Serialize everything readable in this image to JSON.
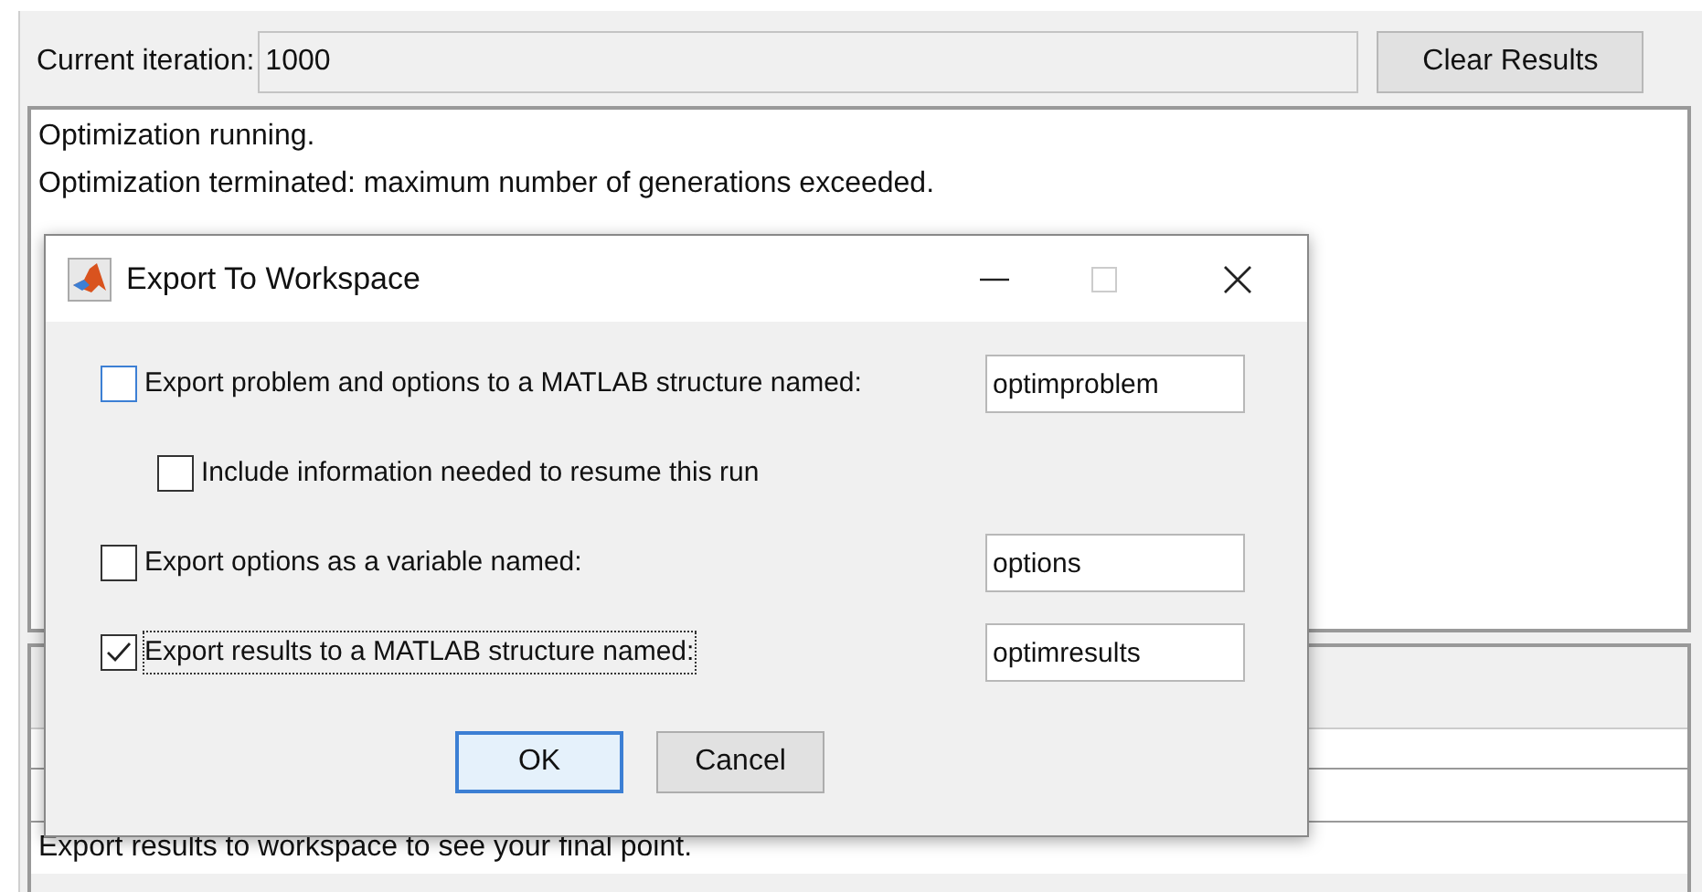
{
  "iteration": {
    "label": "Current iteration:",
    "value": "1000"
  },
  "clear_button": "Clear Results",
  "output_lines": [
    "Optimization running.",
    "Optimization terminated: maximum number of generations exceeded."
  ],
  "final_point_rows": [
    "Export results to workspace to see your final point."
  ],
  "dialog": {
    "title": "Export To Workspace",
    "options": [
      {
        "label": "Export problem and options to a MATLAB structure named:",
        "checked": false,
        "focused": false,
        "indented": false,
        "value": "optimproblem"
      },
      {
        "label": "Include information needed to resume this run",
        "checked": false,
        "focused": false,
        "indented": true
      },
      {
        "label": "Export options as a variable named:",
        "checked": false,
        "focused": false,
        "indented": false,
        "value": "options"
      },
      {
        "label": "Export results to a MATLAB structure named:",
        "checked": true,
        "focused": true,
        "indented": false,
        "value": "optimresults"
      }
    ],
    "buttons": [
      {
        "label": "OK",
        "default": true
      },
      {
        "label": "Cancel",
        "default": false
      }
    ]
  }
}
